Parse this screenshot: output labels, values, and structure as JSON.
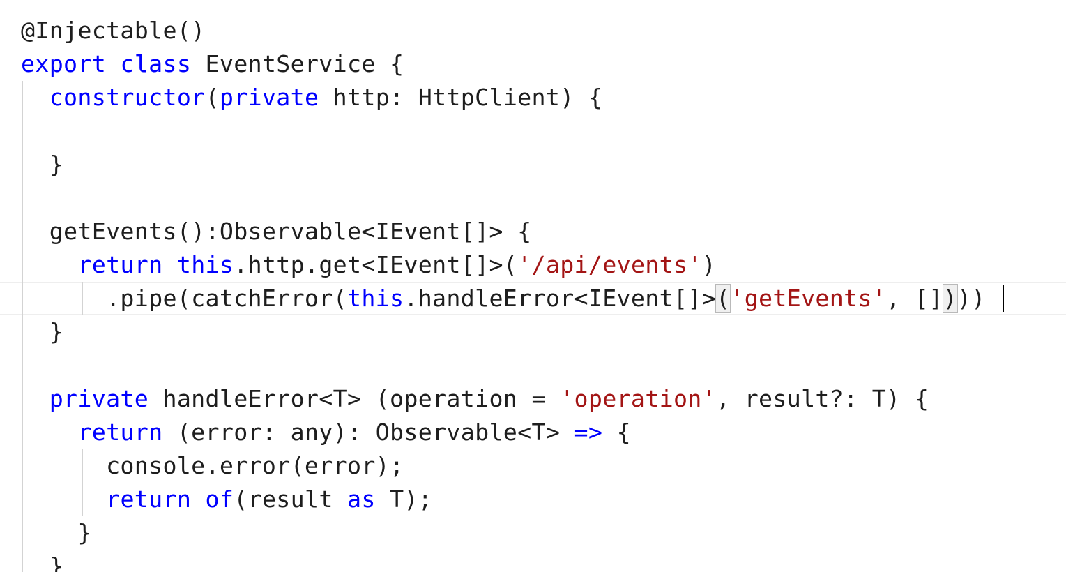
{
  "editor": {
    "language": "typescript",
    "colors": {
      "keyword": "#0000ff",
      "string": "#a31515",
      "plain": "#1e1e1e",
      "background": "#ffffff",
      "indent_guide": "#d3d3d3",
      "current_line_border": "#eeeeee"
    },
    "lines": [
      {
        "tokens": [
          {
            "t": "@Injectable()",
            "k": "plain"
          }
        ]
      },
      {
        "tokens": [
          {
            "t": "export",
            "k": "kw"
          },
          {
            "t": " ",
            "k": "plain"
          },
          {
            "t": "class",
            "k": "kw"
          },
          {
            "t": " EventService {",
            "k": "plain"
          }
        ]
      },
      {
        "tokens": [
          {
            "t": "  ",
            "k": "plain"
          },
          {
            "t": "constructor",
            "k": "kw"
          },
          {
            "t": "(",
            "k": "plain"
          },
          {
            "t": "private",
            "k": "kw"
          },
          {
            "t": " http: HttpClient) {",
            "k": "plain"
          }
        ]
      },
      {
        "tokens": []
      },
      {
        "tokens": [
          {
            "t": "  }",
            "k": "plain"
          }
        ]
      },
      {
        "tokens": []
      },
      {
        "tokens": [
          {
            "t": "  getEvents():Observable<IEvent[]> {",
            "k": "plain"
          }
        ]
      },
      {
        "tokens": [
          {
            "t": "    ",
            "k": "plain"
          },
          {
            "t": "return",
            "k": "kw"
          },
          {
            "t": " ",
            "k": "plain"
          },
          {
            "t": "this",
            "k": "kw"
          },
          {
            "t": ".http.get<IEvent[]>(",
            "k": "plain"
          },
          {
            "t": "'/api/events'",
            "k": "str"
          },
          {
            "t": ")",
            "k": "plain"
          }
        ]
      },
      {
        "current": true,
        "tokens": [
          {
            "t": "      .pipe(catchError(",
            "k": "plain"
          },
          {
            "t": "this",
            "k": "kw"
          },
          {
            "t": ".handleError<IEvent[]>",
            "k": "plain"
          },
          {
            "t": "(",
            "k": "plain",
            "match": true
          },
          {
            "t": "'getEvents'",
            "k": "str"
          },
          {
            "t": ", []",
            "k": "plain"
          },
          {
            "t": ")",
            "k": "plain",
            "match": true
          },
          {
            "t": "))",
            "k": "plain"
          }
        ]
      },
      {
        "tokens": [
          {
            "t": "  }",
            "k": "plain"
          }
        ]
      },
      {
        "tokens": []
      },
      {
        "tokens": [
          {
            "t": "  ",
            "k": "plain"
          },
          {
            "t": "private",
            "k": "kw"
          },
          {
            "t": " handleError<T> (operation = ",
            "k": "plain"
          },
          {
            "t": "'operation'",
            "k": "str"
          },
          {
            "t": ", result?: T) {",
            "k": "plain"
          }
        ]
      },
      {
        "tokens": [
          {
            "t": "    ",
            "k": "plain"
          },
          {
            "t": "return",
            "k": "kw"
          },
          {
            "t": " (error: any): Observable<T> ",
            "k": "plain"
          },
          {
            "t": "=>",
            "k": "kw"
          },
          {
            "t": " {",
            "k": "plain"
          }
        ]
      },
      {
        "tokens": [
          {
            "t": "      console.error(error);",
            "k": "plain"
          }
        ]
      },
      {
        "tokens": [
          {
            "t": "      ",
            "k": "plain"
          },
          {
            "t": "return",
            "k": "kw"
          },
          {
            "t": " ",
            "k": "plain"
          },
          {
            "t": "of",
            "k": "kw"
          },
          {
            "t": "(result ",
            "k": "plain"
          },
          {
            "t": "as",
            "k": "kw"
          },
          {
            "t": " T);",
            "k": "plain"
          }
        ]
      },
      {
        "tokens": [
          {
            "t": "    }",
            "k": "plain"
          }
        ]
      },
      {
        "tokens": [
          {
            "t": "  }",
            "k": "plain"
          }
        ]
      }
    ]
  }
}
